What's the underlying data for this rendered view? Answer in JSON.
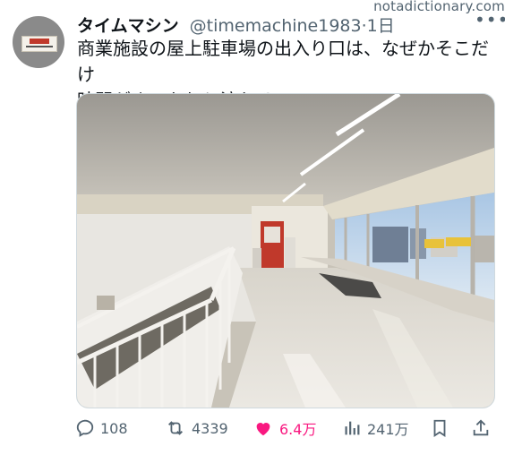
{
  "watermark": "notadictionary.com",
  "tweet": {
    "display_name": "タイムマシン",
    "handle": "@timemachine1983",
    "separator": "·",
    "time": "1日",
    "text_line1": "商業施設の屋上駐車場の出入り口は、なぜかそこだけ",
    "text_line2": "時間がゆったりと流れる。",
    "more_icon": "ellipsis-icon"
  },
  "actions": {
    "replies": "108",
    "retweets": "4339",
    "likes": "6.4万",
    "views": "241万",
    "icons": [
      "reply-icon",
      "retweet-icon",
      "like-icon",
      "views-icon",
      "bookmark-icon",
      "share-icon"
    ],
    "like_color": "#f91880",
    "muted_color": "#536471"
  }
}
